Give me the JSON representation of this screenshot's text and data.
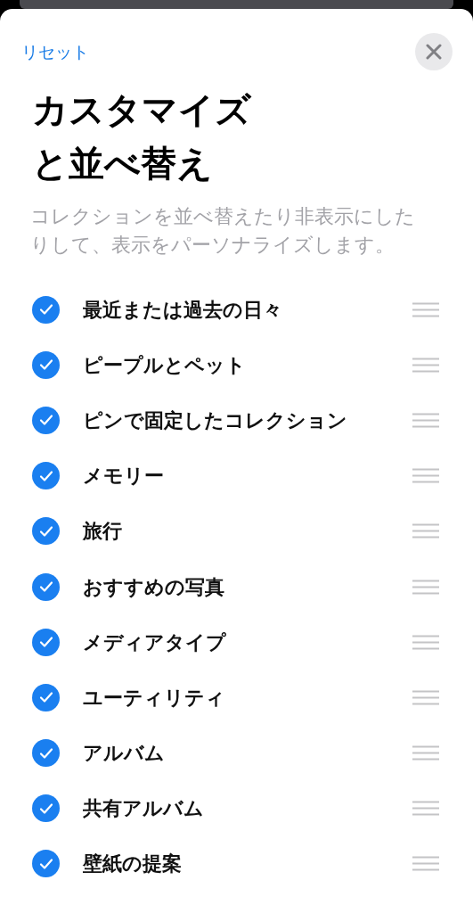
{
  "reset_button": "リセット",
  "title": [
    "カスタマイズ",
    "と並べ替え"
  ],
  "subtitle": "コレクションを並べ替えたり非表示にしたりして、表示をパーソナライズします。",
  "items": [
    {
      "label": "最近または過去の日々",
      "checked": true
    },
    {
      "label": "ピープルとペット",
      "checked": true
    },
    {
      "label": "ピンで固定したコレクション",
      "checked": true
    },
    {
      "label": "メモリー",
      "checked": true
    },
    {
      "label": "旅行",
      "checked": true
    },
    {
      "label": "おすすめの写真",
      "checked": true
    },
    {
      "label": "メディアタイプ",
      "checked": true
    },
    {
      "label": "ユーティリティ",
      "checked": true
    },
    {
      "label": "アルバム",
      "checked": true
    },
    {
      "label": "共有アルバム",
      "checked": true
    },
    {
      "label": "壁紙の提案",
      "checked": true
    }
  ]
}
